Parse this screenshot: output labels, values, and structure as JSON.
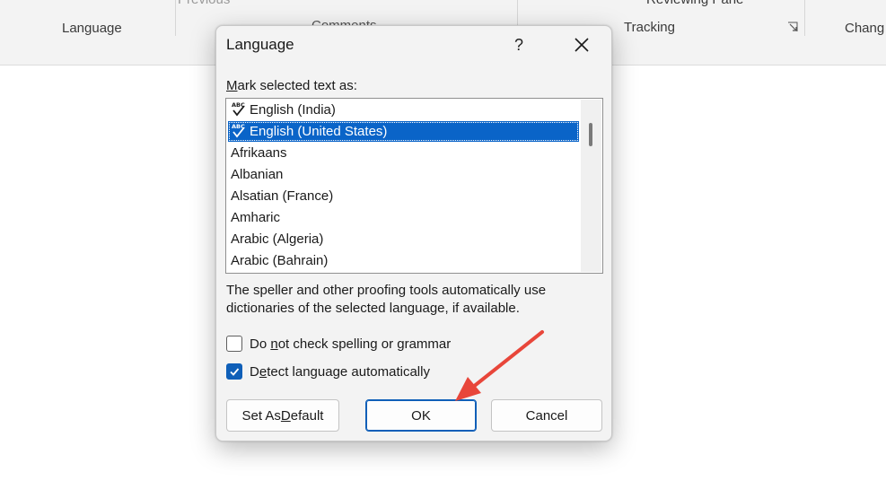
{
  "ribbon": {
    "previous_label": "Previous",
    "comments_label": "Comments",
    "reviewing_pane_label": "Reviewing Pane",
    "group_language": "Language",
    "group_tracking": "Tracking",
    "group_changes": "Chang"
  },
  "dialog": {
    "title": "Language",
    "help_label": "?",
    "mark_label_first": "M",
    "mark_label_rest": "ark selected text as:",
    "languages": [
      {
        "label": "English (India)",
        "proofing_icon": true,
        "selected": false
      },
      {
        "label": "English (United States)",
        "proofing_icon": true,
        "selected": true
      },
      {
        "label": "Afrikaans",
        "proofing_icon": false,
        "selected": false
      },
      {
        "label": "Albanian",
        "proofing_icon": false,
        "selected": false
      },
      {
        "label": "Alsatian (France)",
        "proofing_icon": false,
        "selected": false
      },
      {
        "label": "Amharic",
        "proofing_icon": false,
        "selected": false
      },
      {
        "label": "Arabic (Algeria)",
        "proofing_icon": false,
        "selected": false
      },
      {
        "label": "Arabic (Bahrain)",
        "proofing_icon": false,
        "selected": false
      }
    ],
    "note": "The speller and other proofing tools automatically use dictionaries of the selected language, if available.",
    "no_check": {
      "pre": "Do ",
      "u": "n",
      "post": "ot check spelling or grammar",
      "checked": false
    },
    "detect": {
      "pre": "D",
      "u": "e",
      "post": "tect language automatically",
      "checked": true
    },
    "buttons": {
      "set_default_pre": "Set As ",
      "set_default_u": "D",
      "set_default_post": "efault",
      "ok": "OK",
      "cancel": "Cancel"
    }
  },
  "colors": {
    "selection": "#0a64c8",
    "accent": "#0f5fb8",
    "annotation_arrow": "#e8463a"
  }
}
